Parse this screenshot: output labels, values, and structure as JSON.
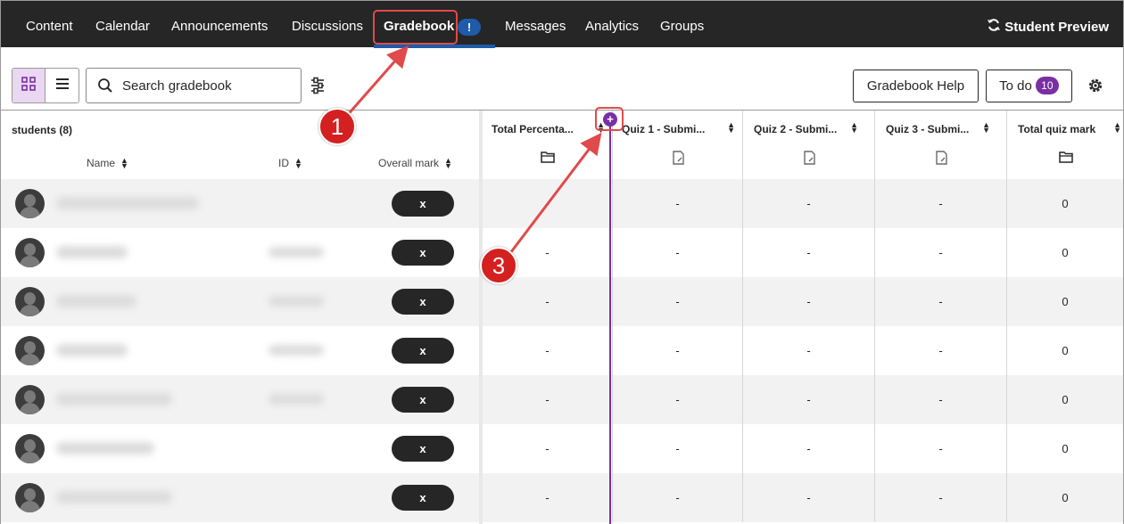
{
  "nav": {
    "items": [
      {
        "label": "Content"
      },
      {
        "label": "Calendar"
      },
      {
        "label": "Announcements"
      },
      {
        "label": "Discussions"
      },
      {
        "label": "Gradebook",
        "active": true,
        "badge": "!"
      },
      {
        "label": "Messages"
      },
      {
        "label": "Analytics"
      },
      {
        "label": "Groups"
      }
    ],
    "student_preview": "Student Preview"
  },
  "toolbar": {
    "search_placeholder": "Search gradebook",
    "help_label": "Gradebook Help",
    "todo_label": "To do",
    "todo_count": "10"
  },
  "grid": {
    "students_label": "students (8)",
    "col_name": "Name",
    "col_id": "ID",
    "col_overall": "Overall mark",
    "columns": [
      {
        "title": "Total Percenta...",
        "icon": "folder-icon"
      },
      {
        "title": "Quiz 1 - Submi...",
        "icon": "document-icon"
      },
      {
        "title": "Quiz 2 - Submi...",
        "icon": "document-icon"
      },
      {
        "title": "Quiz 3 - Submi...",
        "icon": "document-icon"
      },
      {
        "title": "Total quiz mark",
        "icon": "folder-icon"
      }
    ],
    "rows": [
      {
        "mark": "x",
        "cells": [
          "-",
          "-",
          "-",
          "-",
          "0"
        ]
      },
      {
        "mark": "x",
        "cells": [
          "-",
          "-",
          "-",
          "-",
          "0"
        ]
      },
      {
        "mark": "x",
        "cells": [
          "-",
          "-",
          "-",
          "-",
          "0"
        ]
      },
      {
        "mark": "x",
        "cells": [
          "-",
          "-",
          "-",
          "-",
          "0"
        ]
      },
      {
        "mark": "x",
        "cells": [
          "-",
          "-",
          "-",
          "-",
          "0"
        ]
      },
      {
        "mark": "x",
        "cells": [
          "-",
          "-",
          "-",
          "-",
          "0"
        ]
      },
      {
        "mark": "x",
        "cells": [
          "-",
          "-",
          "-",
          "-",
          "0"
        ]
      }
    ]
  },
  "callouts": {
    "one": "1",
    "three": "3"
  },
  "colors": {
    "nav_bg": "#262626",
    "accent_purple": "#7a2fa3",
    "callout_red": "#d42020",
    "nav_active_blue": "#1e5ba8"
  }
}
